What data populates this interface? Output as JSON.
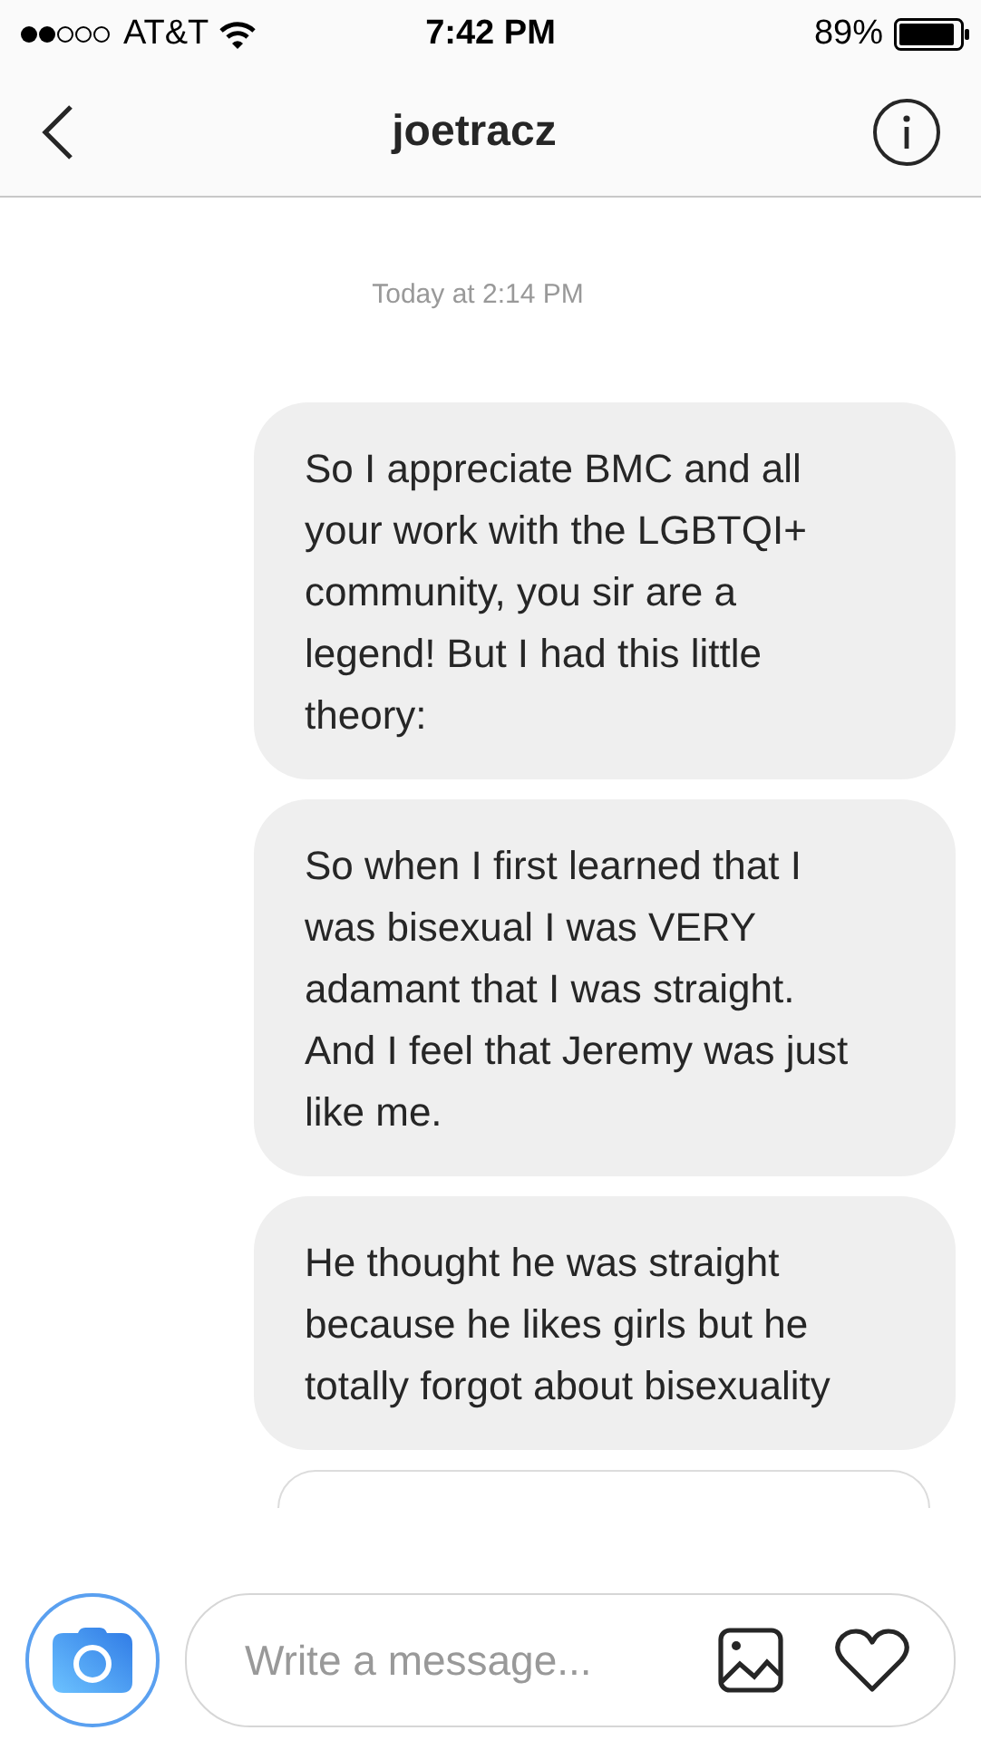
{
  "status_bar": {
    "carrier": "AT&T",
    "time": "7:42 PM",
    "battery": "89%"
  },
  "header": {
    "title": "joetracz"
  },
  "timestamp": "Today at 2:14 PM",
  "messages": [
    {
      "text": "So I appreciate BMC and all your work with the LGBTQI+ community, you sir are a legend! But I had this little theory:"
    },
    {
      "text": "So when I first learned that I was bisexual I was VERY adamant that I was straight. And I feel that Jeremy was just like me."
    },
    {
      "text": "He thought he was straight because he likes girls but he totally forgot about bisexuality"
    }
  ],
  "composer": {
    "placeholder": "Write a message..."
  }
}
